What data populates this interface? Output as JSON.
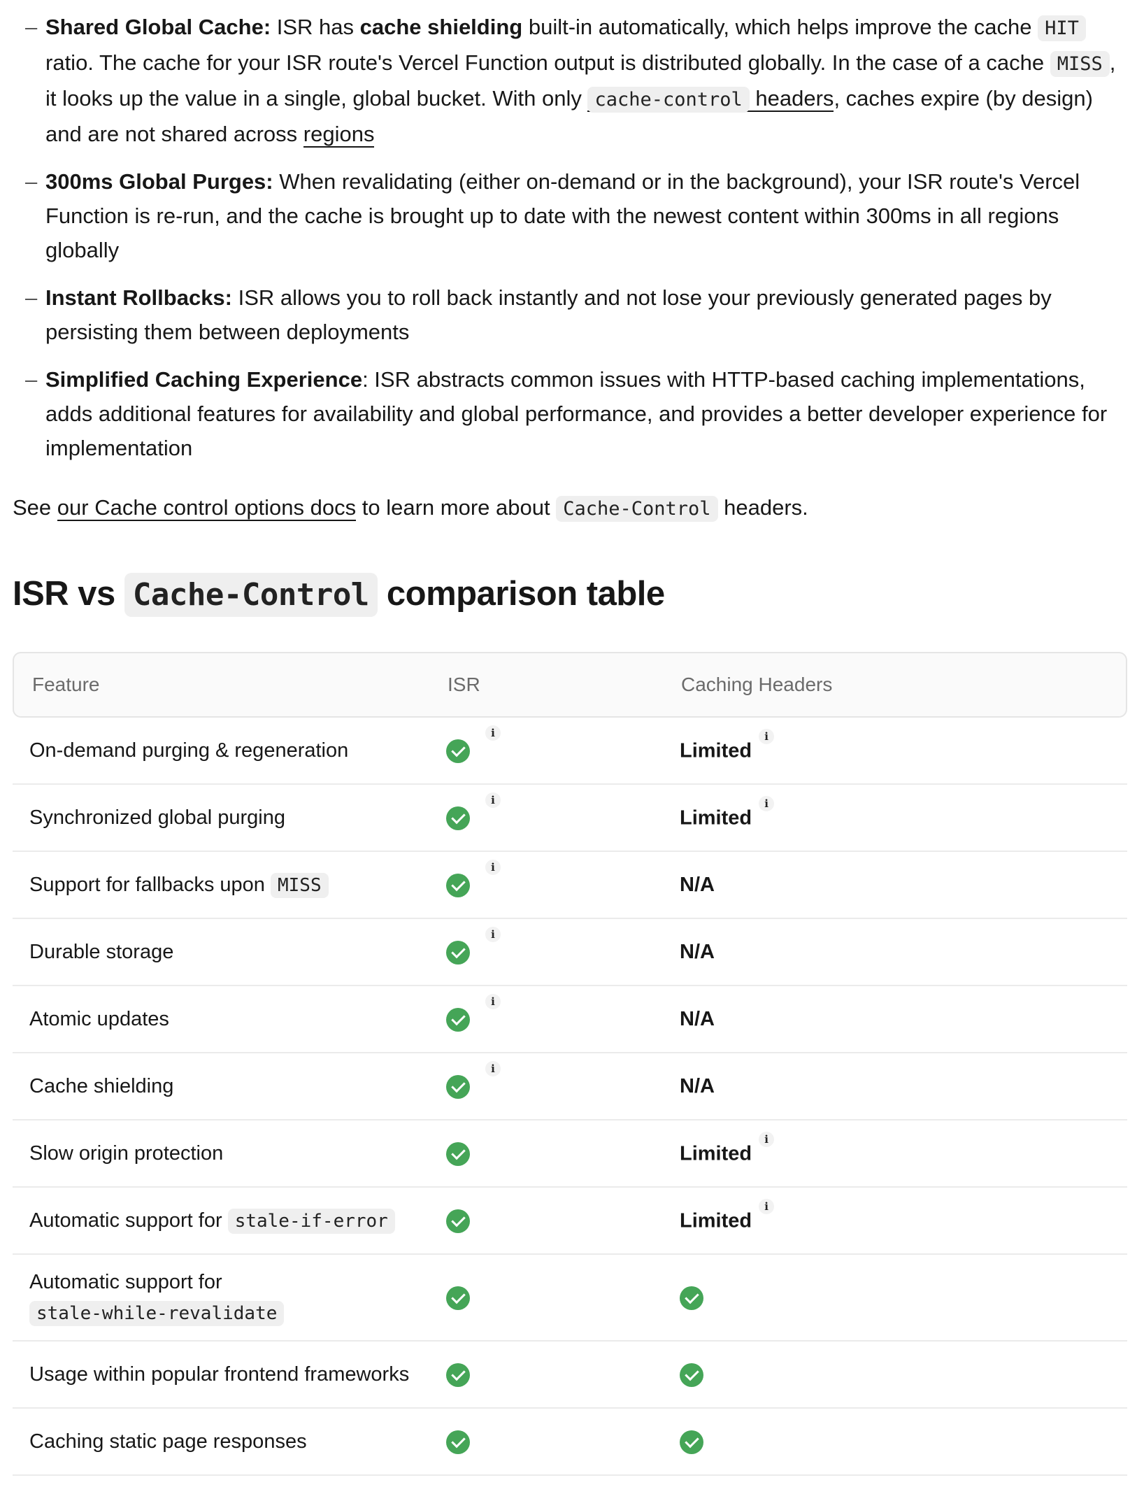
{
  "bullets": [
    {
      "title": "Shared Global Cache:",
      "t1": " ISR has ",
      "bold2": "cache shielding",
      "t2": " built-in automatically, which helps improve the cache ",
      "code1": "HIT",
      "t3": " ratio. The cache for your ISR route's Vercel Function output is distributed globally. In the case of a cache ",
      "code2": "MISS",
      "t4": ", it looks up the value in a single, global bucket. With only ",
      "link_code": "cache-control",
      "link_text": "headers",
      "t5": ", caches expire (by design) and are not shared across ",
      "link2": "regions"
    },
    {
      "title": "300ms Global Purges:",
      "text": " When revalidating (either on-demand or in the background), your ISR route's Vercel Function is re-run, and the cache is brought up to date with the newest content within 300ms in all regions globally"
    },
    {
      "title": "Instant Rollbacks:",
      "text": " ISR allows you to roll back instantly and not lose your previously generated pages by persisting them between deployments"
    },
    {
      "title": "Simplified Caching Experience",
      "text": ": ISR abstracts common issues with HTTP-based caching implementations, adds additional features for availability and global performance, and provides a better developer experience for implementation"
    }
  ],
  "see": {
    "prefix": "See ",
    "link": "our Cache control options docs",
    "middle": " to learn more about ",
    "code": "Cache-Control",
    "suffix": " headers."
  },
  "heading": {
    "pre": "ISR vs ",
    "code": "Cache-Control",
    "post": " comparison table"
  },
  "table": {
    "headers": [
      "Feature",
      "ISR",
      "Caching Headers"
    ],
    "rows": [
      {
        "feature": "On-demand purging & regeneration",
        "isr": "check",
        "isr_info": true,
        "ch": "Limited",
        "ch_info": true
      },
      {
        "feature": "Synchronized global purging",
        "isr": "check",
        "isr_info": true,
        "ch": "Limited",
        "ch_info": true
      },
      {
        "feature": "Support for fallbacks upon ",
        "feature_code": "MISS",
        "isr": "check",
        "isr_info": true,
        "ch": "N/A",
        "ch_info": false
      },
      {
        "feature": "Durable storage",
        "isr": "check",
        "isr_info": true,
        "ch": "N/A",
        "ch_info": false
      },
      {
        "feature": "Atomic updates",
        "isr": "check",
        "isr_info": true,
        "ch": "N/A",
        "ch_info": false
      },
      {
        "feature": "Cache shielding",
        "isr": "check",
        "isr_info": true,
        "ch": "N/A",
        "ch_info": false
      },
      {
        "feature": "Slow origin protection",
        "isr": "check",
        "isr_info": false,
        "ch": "Limited",
        "ch_info": true
      },
      {
        "feature": "Automatic support for ",
        "feature_code": "stale-if-error",
        "isr": "check",
        "isr_info": false,
        "ch": "Limited",
        "ch_info": true
      },
      {
        "feature": "Automatic support for",
        "feature_code": "stale-while-revalidate",
        "break": true,
        "isr": "check",
        "isr_info": false,
        "ch": "check",
        "ch_info": false
      },
      {
        "feature": "Usage within popular frontend frameworks",
        "isr": "check",
        "isr_info": false,
        "ch": "check",
        "ch_info": false
      },
      {
        "feature": "Caching static page responses",
        "isr": "check",
        "isr_info": false,
        "ch": "check",
        "ch_info": false
      }
    ],
    "info_glyph": "i",
    "check_color": "#45a557"
  }
}
